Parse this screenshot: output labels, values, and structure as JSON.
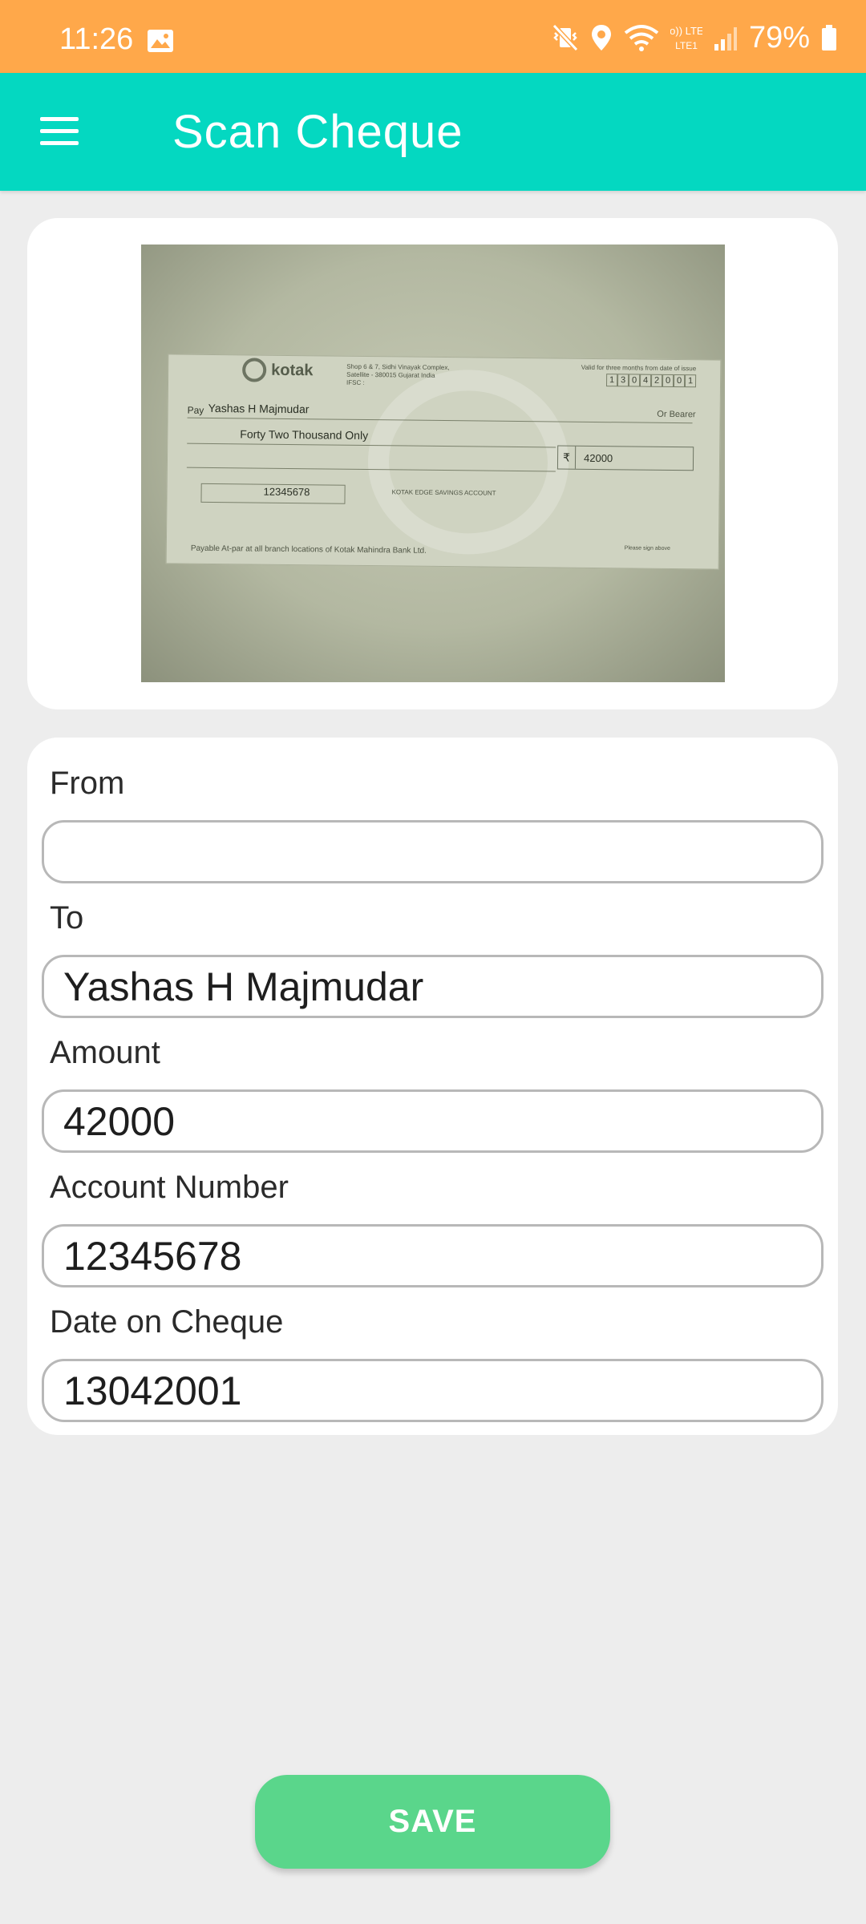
{
  "status_bar": {
    "time": "11:26",
    "battery": "79%",
    "network_label": "Vo)) LTE1",
    "icons": [
      "gallery-icon",
      "mute-vibrate-icon",
      "location-icon",
      "wifi-icon",
      "lte-icon",
      "signal-icon",
      "battery-icon"
    ]
  },
  "app_bar": {
    "title": "Scan Cheque",
    "menu_icon": "hamburger-menu-icon"
  },
  "cheque_image": {
    "bank": "kotak",
    "bank_subtitle": "Kotak Mahindra Bank",
    "branch_address": "Shop 6 & 7, Sidhi Vinayak Complex, Satellite - 380015 Gujarat India IFSC :",
    "validity_note": "Valid for three months from date of issue",
    "date_digits": [
      "1",
      "3",
      "0",
      "4",
      "2",
      "0",
      "0",
      "1"
    ],
    "pay_label": "Pay",
    "payee": "Yashas H Majmudar",
    "bearer": "Or Bearer",
    "amount_in_words": "Forty Two Thousand Only",
    "rupee_symbol": "₹",
    "amount": "42000",
    "account_number": "12345678",
    "account_type": "KOTAK EDGE SAVINGS ACCOUNT",
    "payable_note": "Payable At-par at all branch locations of Kotak Mahindra Bank Ltd.",
    "signature_note": "Please sign above"
  },
  "form": {
    "from": {
      "label": "From",
      "value": ""
    },
    "to": {
      "label": "To",
      "value": "Yashas H Majmudar"
    },
    "amount": {
      "label": "Amount",
      "value": "42000"
    },
    "account_number": {
      "label": "Account Number",
      "value": "12345678"
    },
    "date_on_cheque": {
      "label": "Date on Cheque",
      "value": "13042001"
    }
  },
  "save_button": {
    "label": "SAVE"
  },
  "colors": {
    "status_bar": "#ffa84a",
    "app_bar": "#04d8c1",
    "save_button": "#5ad68b",
    "background": "#ededed"
  }
}
